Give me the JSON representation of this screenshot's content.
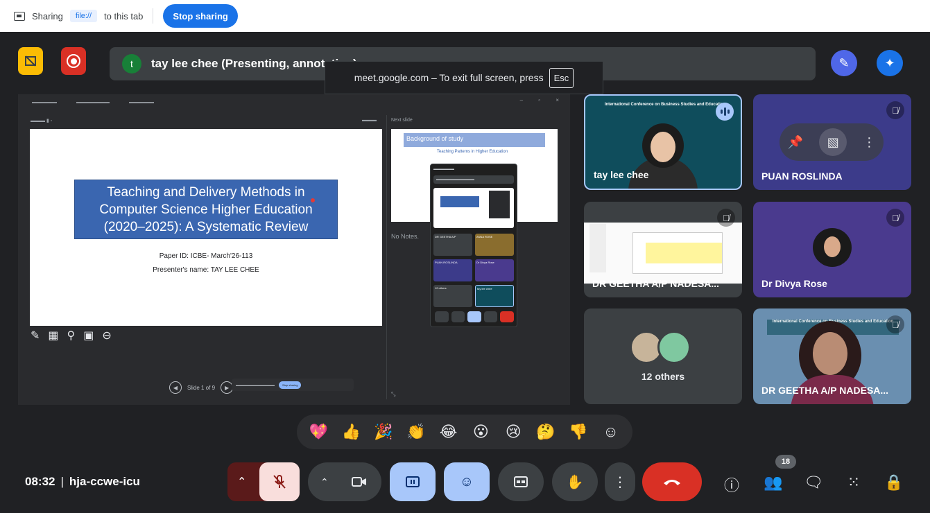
{
  "share_strip": {
    "sharing_label": "Sharing",
    "shared_item": "file://",
    "suffix": "to this tab",
    "stop_button": "Stop sharing"
  },
  "top_bar": {
    "presenter_initial": "t",
    "presenter_text": "tay lee chee (Presenting, annotating)",
    "fullscreen_message": "meet.google.com – To exit full screen, press",
    "esc_key": "Esc"
  },
  "shared_screen": {
    "presenter_view": {
      "next_slide_label": "Next slide",
      "notes": "No Notes.",
      "slide_counter": "Slide 1 of 9"
    },
    "current_slide": {
      "title": "Teaching and Delivery Methods in\nComputer Science Higher Education\n(2020–2025): A Systematic Review",
      "paper_id": "Paper ID: ICBE- March'26-113",
      "presenter": "Presenter's name: TAY LEE CHEE"
    },
    "next_slide": {
      "title": "Background of study",
      "subtitle": "Teaching Patterns in Higher Education"
    },
    "mini_meet": {
      "tiles": [
        "DR GEETHA A/P",
        "ANNA ROSE",
        "PUAN ROSLINDA",
        "Dr Divya Rose",
        "12 others",
        "tay lee chee"
      ]
    },
    "mini_share_bar": {
      "stop_label": "Stop sharing"
    }
  },
  "participants": [
    {
      "name": "tay lee chee",
      "state": "speaking",
      "banner": "International Conference on Business Studies and Education"
    },
    {
      "name": "PUAN ROSLINDA",
      "state": "muted"
    },
    {
      "name": "DR GEETHA A/P NADESA...",
      "state": "muted"
    },
    {
      "name": "Dr Divya Rose",
      "state": "muted"
    },
    {
      "name": "12 others",
      "state": "group"
    },
    {
      "name": "DR GEETHA A/P NADESA...",
      "state": "muted",
      "banner": "International Conference on Business Studies and Education"
    }
  ],
  "reactions": [
    "💖",
    "👍",
    "🎉",
    "👏",
    "😂",
    "😮",
    "😢",
    "🤔",
    "👎",
    "☺"
  ],
  "bottom_bar": {
    "time": "08:32",
    "separator": "|",
    "meeting_code": "hja-ccwe-icu",
    "participant_count": "18"
  },
  "colors": {
    "background": "#202124",
    "stop_sharing": "#1a73e8",
    "end_call": "#d93025",
    "mic_muted": "#f9dedc",
    "active_control": "#a8c7fa"
  },
  "icons": [
    "screen-share-icon",
    "no-annotate-icon",
    "record-icon",
    "annotate-pen-icon",
    "gemini-icon",
    "pin-icon",
    "muted-mic-icon",
    "speaking-icon",
    "camera-icon",
    "present-icon",
    "emoji-icon",
    "captions-icon",
    "raise-hand-icon",
    "more-options-icon",
    "end-call-icon",
    "info-icon",
    "people-icon",
    "chat-icon",
    "activities-icon",
    "host-controls-icon"
  ]
}
